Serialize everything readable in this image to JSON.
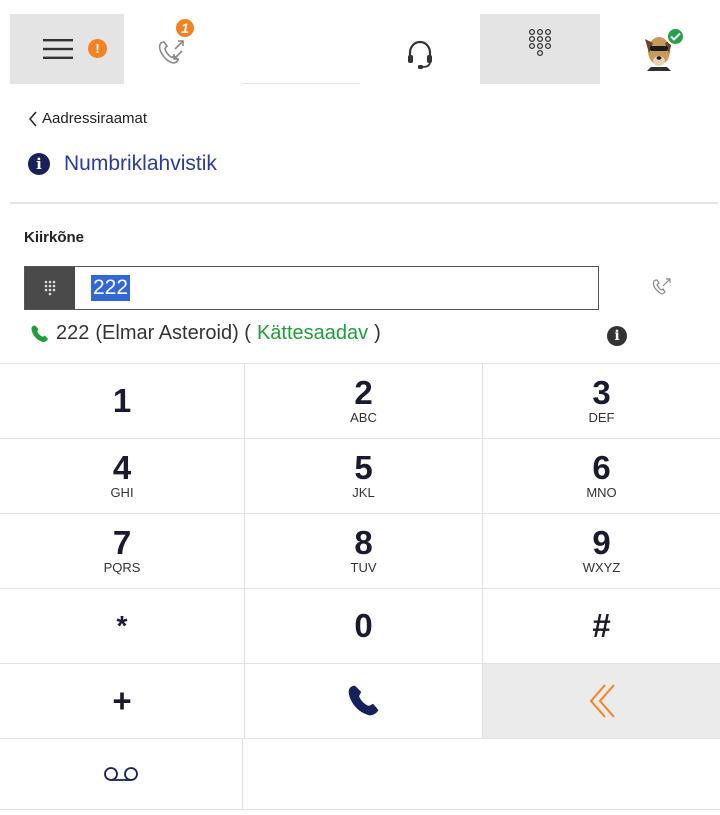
{
  "topbar": {
    "menu_icon": "hamburger-menu-icon",
    "alert_badge": "!",
    "missed_calls_count": "1",
    "calls_icon": "call-transfer-icon",
    "headset_icon": "headset-icon",
    "dialpad_icon": "dialpad-icon",
    "avatar_status": "available"
  },
  "breadcrumb": {
    "label": "Aadressiraamat"
  },
  "section": {
    "title": "Numbriklahvistik",
    "info_symbol": "i"
  },
  "field": {
    "label": "Kiirkõne",
    "value": "222"
  },
  "result": {
    "number": "222",
    "name": "(Elmar Asteroid) (",
    "status": "Kättesaadav",
    "close_paren": ")",
    "info_symbol": "i"
  },
  "keypad": {
    "keys": [
      {
        "digit": "1",
        "letters": ""
      },
      {
        "digit": "2",
        "letters": "ABC"
      },
      {
        "digit": "3",
        "letters": "DEF"
      },
      {
        "digit": "4",
        "letters": "GHI"
      },
      {
        "digit": "5",
        "letters": "JKL"
      },
      {
        "digit": "6",
        "letters": "MNO"
      },
      {
        "digit": "7",
        "letters": "PQRS"
      },
      {
        "digit": "8",
        "letters": "TUV"
      },
      {
        "digit": "9",
        "letters": "WXYZ"
      },
      {
        "digit": "*",
        "letters": ""
      },
      {
        "digit": "0",
        "letters": ""
      },
      {
        "digit": "#",
        "letters": ""
      }
    ],
    "plus": "+"
  },
  "colors": {
    "accent_orange": "#f58220",
    "link_blue": "#2b3a9e",
    "available_green": "#1f9e3a",
    "call_navy": "#16205a"
  }
}
